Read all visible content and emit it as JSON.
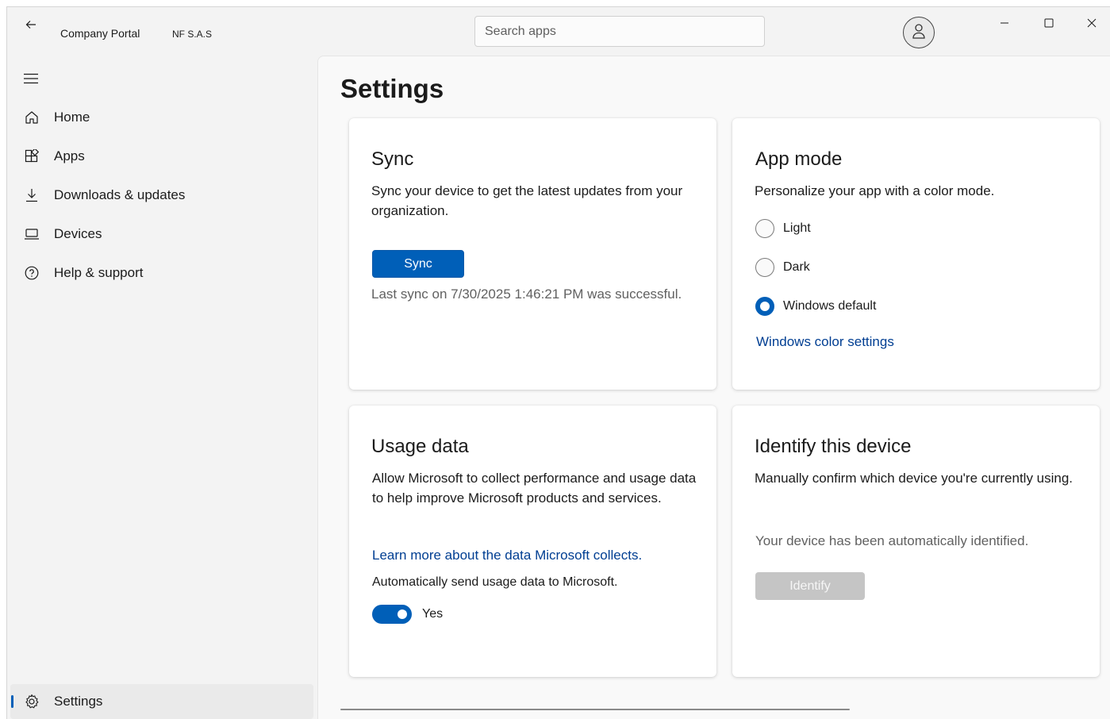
{
  "titlebar": {
    "app_title": "Company Portal",
    "org_name": "NF S.A.S",
    "search_placeholder": "Search apps"
  },
  "sidebar": {
    "items": [
      {
        "label": "Home",
        "icon": "home-icon"
      },
      {
        "label": "Apps",
        "icon": "apps-icon"
      },
      {
        "label": "Downloads & updates",
        "icon": "download-icon"
      },
      {
        "label": "Devices",
        "icon": "laptop-icon"
      },
      {
        "label": "Help & support",
        "icon": "help-icon"
      }
    ],
    "settings_label": "Settings"
  },
  "page": {
    "title": "Settings"
  },
  "sync_card": {
    "title": "Sync",
    "description": "Sync your device to get the latest updates from your organization.",
    "button_label": "Sync",
    "status": "Last sync on 7/30/2025 1:46:21 PM was successful."
  },
  "app_mode_card": {
    "title": "App mode",
    "description": "Personalize your app with a color mode.",
    "options": [
      "Light",
      "Dark",
      "Windows default"
    ],
    "selected": "Windows default",
    "link": "Windows color settings"
  },
  "usage_card": {
    "title": "Usage data",
    "description": "Allow Microsoft to collect performance and usage data to help improve Microsoft products and services.",
    "link": "Learn more about the data Microsoft collects.",
    "toggle_caption": "Automatically send usage data to Microsoft.",
    "toggle_label": "Yes",
    "toggle_on": true
  },
  "identify_card": {
    "title": "Identify this device",
    "description": "Manually confirm which device you're currently using.",
    "status": "Your device has been automatically identified.",
    "button_label": "Identify"
  },
  "colors": {
    "accent": "#005fb8",
    "link": "#003e92",
    "background": "#f3f3f3"
  }
}
